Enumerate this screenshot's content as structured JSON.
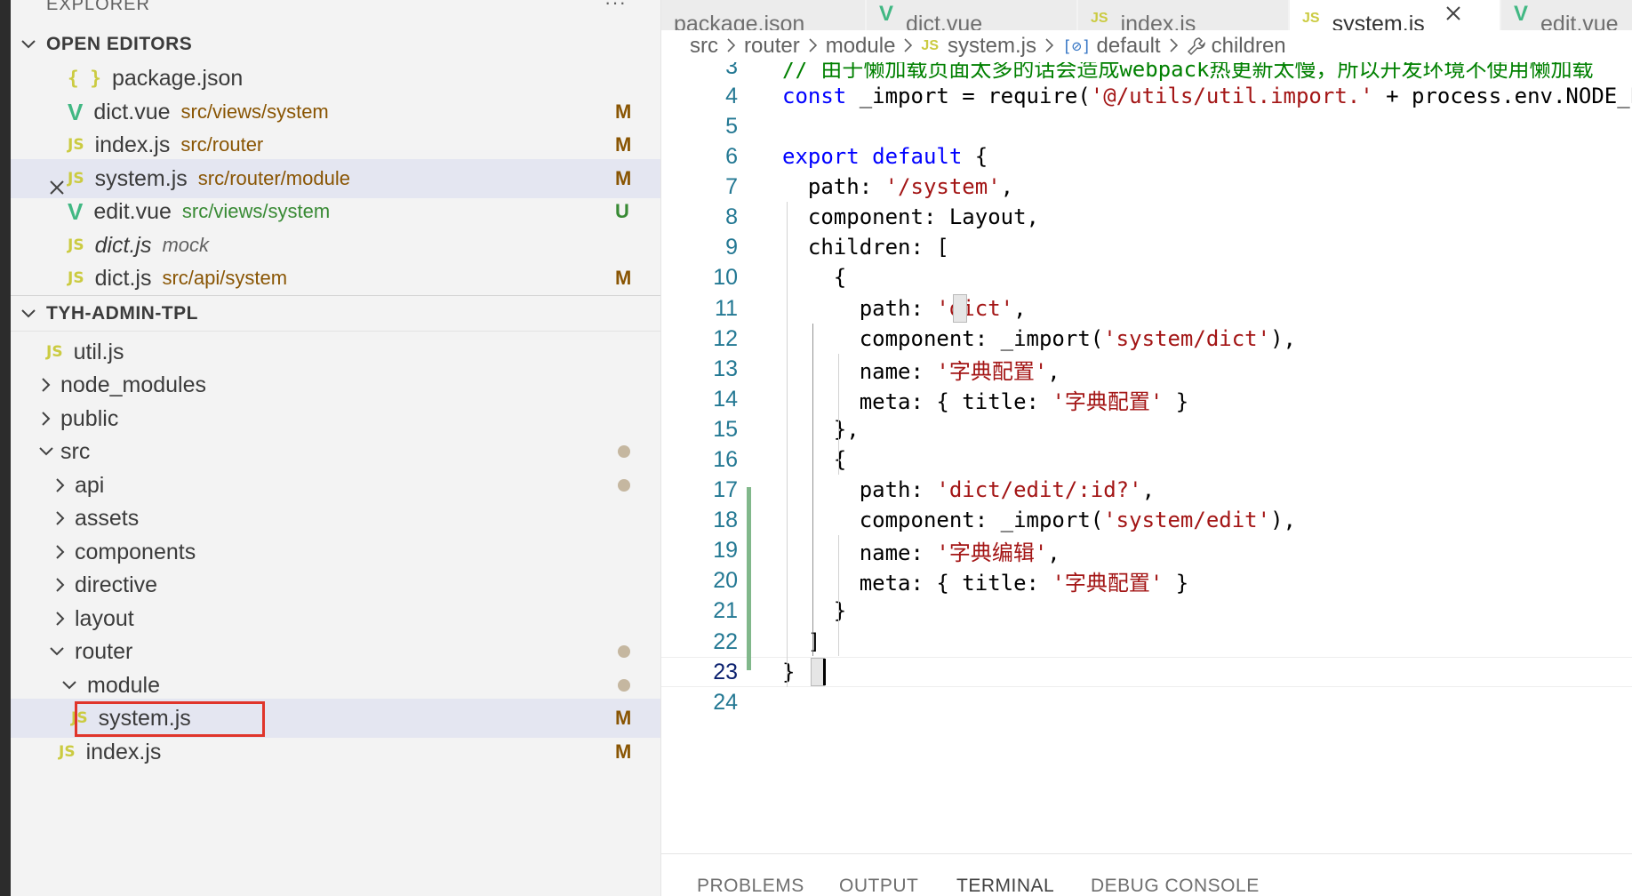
{
  "sidebar": {
    "explorer_title": "EXPLORER",
    "more_actions": "···",
    "open_editors": {
      "header": "OPEN EDITORS",
      "items": [
        {
          "icon": "{ }",
          "name": "package.json",
          "desc": "",
          "badge": ""
        },
        {
          "icon": "V",
          "name": "dict.vue",
          "desc": "src/views/system",
          "badge": "M"
        },
        {
          "icon": "JS",
          "name": "index.js",
          "desc": "src/router",
          "badge": "M"
        },
        {
          "icon": "JS",
          "name": "system.js",
          "desc": "src/router/module",
          "badge": "M"
        },
        {
          "icon": "V",
          "name": "edit.vue",
          "desc": "src/views/system",
          "badge": "U"
        },
        {
          "icon": "JS",
          "name": "dict.js",
          "desc": "mock",
          "badge": ""
        },
        {
          "icon": "JS",
          "name": "dict.js",
          "desc": "src/api/system",
          "badge": "M"
        }
      ]
    },
    "project": {
      "header": "TYH-ADMIN-TPL",
      "items": [
        {
          "icon": "JS",
          "name": "util.js",
          "badge": ""
        },
        {
          "name": "node_modules"
        },
        {
          "name": "public"
        },
        {
          "name": "src"
        },
        {
          "name": "api"
        },
        {
          "name": "assets"
        },
        {
          "name": "components"
        },
        {
          "name": "directive"
        },
        {
          "name": "layout"
        },
        {
          "name": "router"
        },
        {
          "name": "module"
        },
        {
          "icon": "JS",
          "name": "system.js",
          "badge": "M"
        },
        {
          "icon": "JS",
          "name": "index.js",
          "badge": "M"
        }
      ]
    }
  },
  "editor": {
    "tabs": [
      {
        "icon": "{ }",
        "label": "package.json"
      },
      {
        "icon": "V",
        "label": "dict.vue"
      },
      {
        "icon": "JS",
        "label": "index.js"
      },
      {
        "icon": "JS",
        "label": "system.js",
        "close": "✕"
      },
      {
        "icon": "V",
        "label": "edit.vue"
      }
    ],
    "breadcrumb": {
      "parts": [
        "src",
        "router",
        "module",
        "system.js",
        "default",
        "children"
      ],
      "js_icon": "JS",
      "obj_icon": "[⊘]"
    },
    "code": {
      "lines": [
        {
          "num": "3",
          "html": "<span class=\"com\">// 由于懒加载页面太多的话会造成webpack热更新太慢，所以开发环境不使用懒加载</span>"
        },
        {
          "num": "4",
          "html": "<span class=\"kw\">const</span> _import = require(<span class=\"str\">'@/utils/util.import.'</span> + process.env.NODE_ENV)"
        },
        {
          "num": "5",
          "html": ""
        },
        {
          "num": "6",
          "html": "<span class=\"kw\">export</span> <span class=\"kw\">default</span> {"
        },
        {
          "num": "7",
          "html": "  path: <span class=\"str\">'/system'</span>,"
        },
        {
          "num": "8",
          "html": "  component: Layout,"
        },
        {
          "num": "9",
          "html": "  children: ["
        },
        {
          "num": "10",
          "html": "    {"
        },
        {
          "num": "11",
          "html": "      path: <span class=\"str\">'dict'</span>,"
        },
        {
          "num": "12",
          "html": "      component: _import(<span class=\"str\">'system/dict'</span>),"
        },
        {
          "num": "13",
          "html": "      name: <span class=\"str\">'字典配置'</span>,"
        },
        {
          "num": "14",
          "html": "      meta: { title: <span class=\"str\">'字典配置'</span> }"
        },
        {
          "num": "15",
          "html": "    },"
        },
        {
          "num": "16",
          "html": "    {"
        },
        {
          "num": "17",
          "html": "      path: <span class=\"str\">'dict/edit/:id?'</span>,"
        },
        {
          "num": "18",
          "html": "      component: _import(<span class=\"str\">'system/edit'</span>),"
        },
        {
          "num": "19",
          "html": "      name: <span class=\"str\">'字典编辑'</span>,"
        },
        {
          "num": "20",
          "html": "      meta: { title: <span class=\"str\">'字典配置'</span> }"
        },
        {
          "num": "21",
          "html": "    }"
        },
        {
          "num": "22",
          "html": "  ]"
        },
        {
          "num": "23",
          "html": "}"
        },
        {
          "num": "24",
          "html": ""
        }
      ]
    }
  },
  "panel": {
    "tabs": [
      "PROBLEMS",
      "OUTPUT",
      "TERMINAL",
      "DEBUG CONSOLE"
    ],
    "active": "TERMINAL"
  },
  "colors": {
    "modified": "#895503",
    "untracked": "#388a34",
    "js_icon": "#cbcb41",
    "vue_icon": "#41b883",
    "active_row": "#e4e6f1",
    "highlight_box": "#e0352b",
    "keyword": "#0000ff",
    "string": "#a31515",
    "comment": "#008000",
    "git_added_gutter": "#81b88b"
  }
}
